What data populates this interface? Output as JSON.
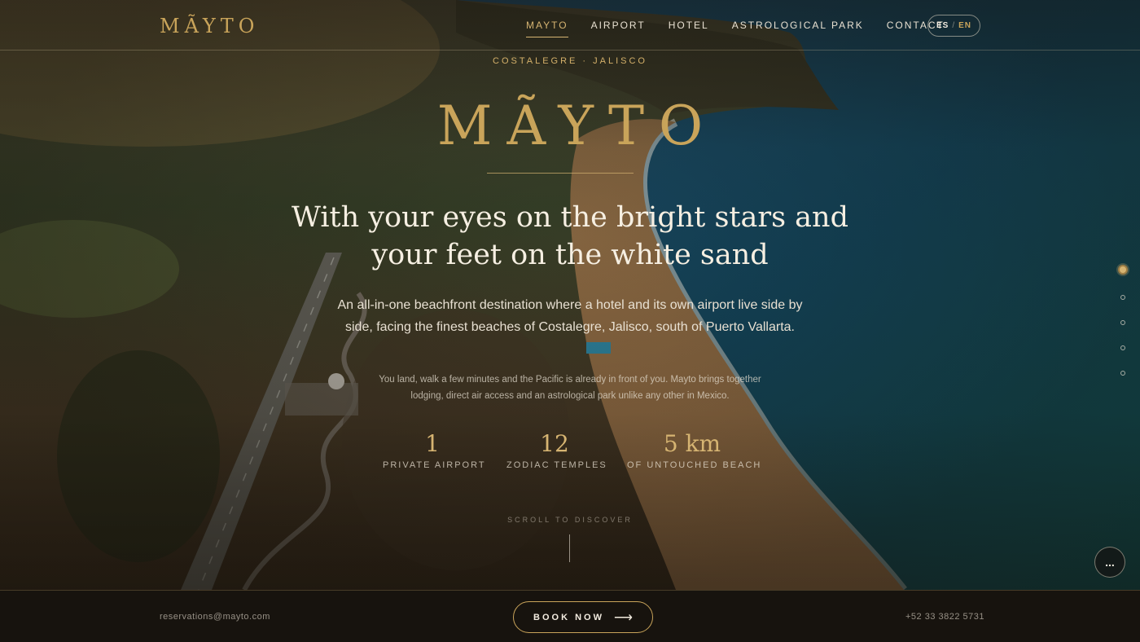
{
  "header": {
    "brand": "MÃYTO",
    "nav": [
      {
        "label": "MAYTO",
        "active": true
      },
      {
        "label": "AIRPORT",
        "active": false
      },
      {
        "label": "HOTEL",
        "active": false
      },
      {
        "label": "ASTROLOGICAL PARK",
        "active": false
      },
      {
        "label": "CONTACT",
        "active": false
      }
    ],
    "lang": {
      "es": "ES",
      "sep": "/",
      "en": "EN"
    }
  },
  "hero": {
    "kicker": "COSTALEGRE · JALISCO",
    "logo": "MÃYTO",
    "headline_line1": "With your eyes on the bright stars and",
    "headline_line2": "your feet on the white sand",
    "lead": "An all-in-one beachfront destination where a hotel and its own airport live side by side, facing the finest beaches of Costalegre, Jalisco, south of Puerto Vallarta.",
    "sub": "You land, walk a few minutes and the Pacific is already in front of you. Mayto brings together lodging, direct air access and an astrological park unlike any other in Mexico.",
    "stats": [
      {
        "value": "1",
        "label": "PRIVATE AIRPORT"
      },
      {
        "value": "12",
        "label": "ZODIAC TEMPLES"
      },
      {
        "value": "5 km",
        "label": "OF UNTOUCHED BEACH"
      }
    ],
    "scroll": "SCROLL TO DISCOVER"
  },
  "side_nav": {
    "count": 5,
    "active_index": 0
  },
  "more_button": "...",
  "footer": {
    "email": "reservations@mayto.com",
    "book_label": "BOOK NOW",
    "book_arrow": "⟶",
    "phone": "+52 33 3822 5731"
  },
  "colors": {
    "accent": "#c9a45a",
    "footer_bg": "#17130e",
    "text": "#f3ece0"
  }
}
